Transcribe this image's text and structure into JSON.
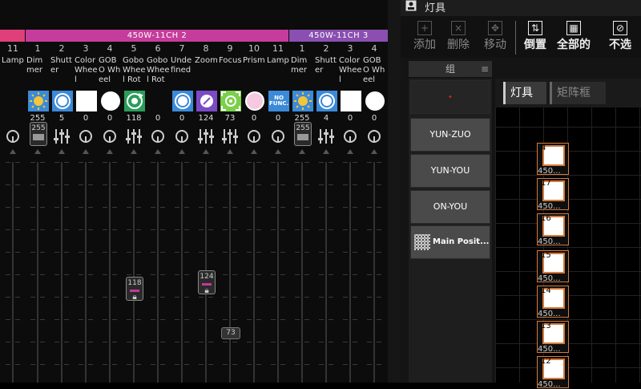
{
  "fixture_groups": [
    {
      "label": "",
      "color": "#e0407a"
    },
    {
      "label": "450W-11CH  2",
      "color": "#c63c9c"
    },
    {
      "label": "450W-11CH  3",
      "color": "#8a4fb0"
    }
  ],
  "channels": [
    {
      "ch": "11",
      "attr": "Lamp",
      "icon": "",
      "val": "",
      "ctl": "knob"
    },
    {
      "ch": "1",
      "attr": "Dimmer",
      "icon": "sun-icon",
      "val": "255",
      "ctl": "bars",
      "fader": "255"
    },
    {
      "ch": "2",
      "attr": "Shutter",
      "icon": "shutter-icon",
      "val": "5",
      "ctl": "sliders"
    },
    {
      "ch": "3",
      "attr": "Color Wheel",
      "icon": "white-square-icon",
      "val": "0",
      "ctl": "knob"
    },
    {
      "ch": "4",
      "attr": "GOBO Wheel",
      "icon": "white-circle-icon",
      "val": "0",
      "ctl": "knob"
    },
    {
      "ch": "5",
      "attr": "Gobo Wheel Rot",
      "icon": "gobo-rotate-icon",
      "val": "118",
      "ctl": "sliders",
      "fader": "118"
    },
    {
      "ch": "6",
      "attr": "Gobo Wheel Rot",
      "icon": "",
      "val": "0",
      "ctl": "knob"
    },
    {
      "ch": "7",
      "attr": "Undefined",
      "icon": "shutter-icon",
      "val": "0",
      "ctl": "knob"
    },
    {
      "ch": "8",
      "attr": "Zoom",
      "icon": "zoom-icon",
      "val": "124",
      "ctl": "sliders",
      "fader": "124"
    },
    {
      "ch": "9",
      "attr": "Focus",
      "icon": "focus-icon",
      "val": "73",
      "ctl": "sliders",
      "fader": "73"
    },
    {
      "ch": "10",
      "attr": "Prism",
      "icon": "pink-circle-icon",
      "val": "0",
      "ctl": "knob"
    },
    {
      "ch": "11",
      "attr": "Lamp",
      "icon": "nofunc-icon",
      "val": "0",
      "ctl": "knob"
    },
    {
      "ch": "1",
      "attr": "Dimmer",
      "icon": "sun-icon",
      "val": "255",
      "ctl": "bars",
      "fader": "255"
    },
    {
      "ch": "2",
      "attr": "Shutter",
      "icon": "shutter-icon",
      "val": "4",
      "ctl": "sliders"
    },
    {
      "ch": "3",
      "attr": "Color Wheel",
      "icon": "white-square-icon",
      "val": "0",
      "ctl": "knob"
    },
    {
      "ch": "4",
      "attr": "GOBO Wheel",
      "icon": "white-circle-icon",
      "val": "0",
      "ctl": "knob"
    }
  ],
  "nofunc_label": "NO FUNC.",
  "right": {
    "title": "灯具",
    "toolbar": [
      {
        "label": "添加",
        "glyph": "+",
        "active": false
      },
      {
        "label": "删除",
        "glyph": "×",
        "active": false
      },
      {
        "label": "移动",
        "glyph": "✥",
        "active": false
      },
      {
        "label": "倒置",
        "glyph": "⇅",
        "active": true
      },
      {
        "label": "全部的",
        "glyph": "▦",
        "active": true
      },
      {
        "label": "不选",
        "glyph": "⊘",
        "active": true
      }
    ],
    "group_header": "组",
    "group_marker": "•",
    "groups": [
      "YUN-ZUO",
      "YUN-YOU",
      "ON-YOU",
      "Main Posit..."
    ],
    "tabs": [
      "灯具",
      "矩阵框"
    ],
    "fixtures": [
      {
        "num": "4",
        "sub": "450..."
      },
      {
        "num": "17",
        "sub": "450..."
      },
      {
        "num": "16",
        "sub": "450..."
      },
      {
        "num": "15",
        "sub": "450..."
      },
      {
        "num": "14",
        "sub": "450..."
      },
      {
        "num": "13",
        "sub": "450..."
      },
      {
        "num": "12",
        "sub": "450..."
      }
    ],
    "accent": "#d57a3a"
  }
}
